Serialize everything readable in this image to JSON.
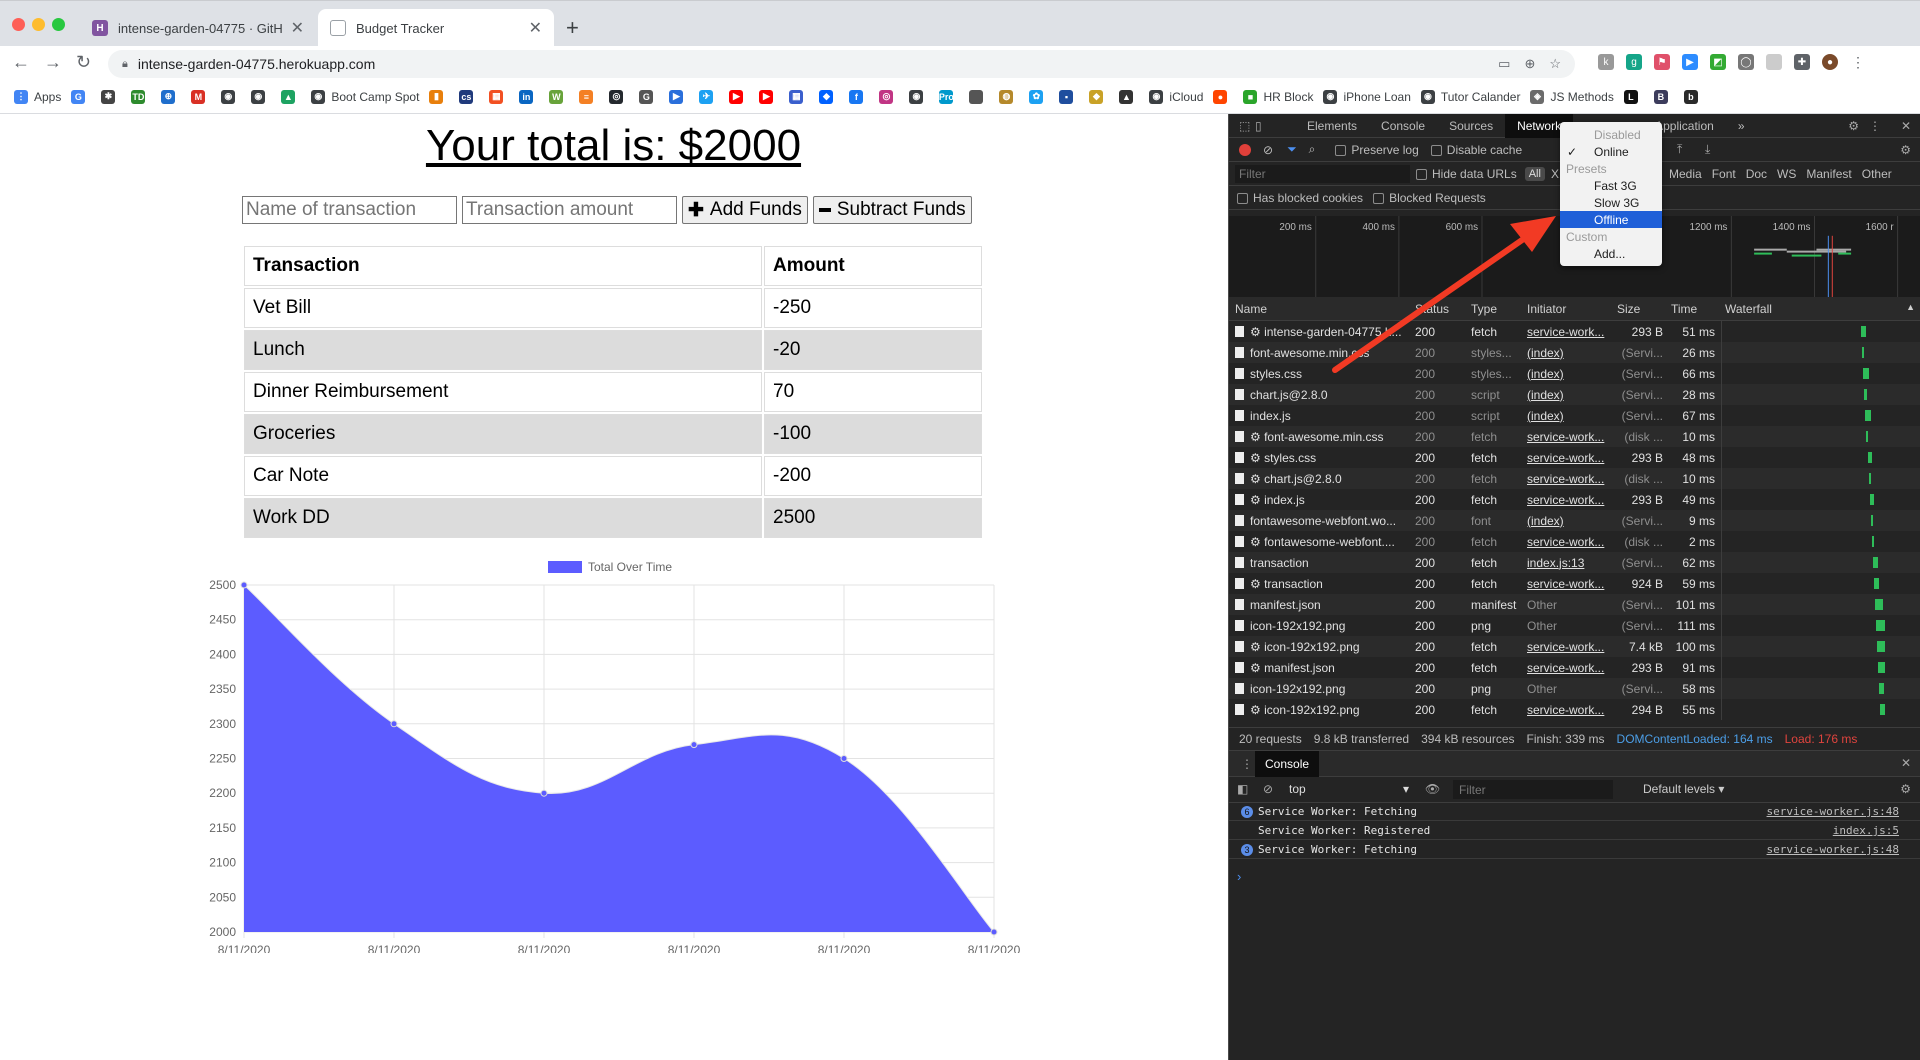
{
  "browser": {
    "tabs": [
      {
        "title": "intense-garden-04775 · GitHub",
        "favicon_color": "#8154a0",
        "favicon_letter": "H"
      },
      {
        "title": "Budget Tracker",
        "favicon_color": "#9aa0a6",
        "favicon_letter": ""
      }
    ],
    "url": "intense-garden-04775.herokuapp.com",
    "bookmarks": [
      {
        "label": "Apps",
        "color": "#4285f4",
        "letter": "⋮"
      },
      {
        "label": "",
        "color": "#4285f4",
        "letter": "G"
      },
      {
        "label": "",
        "color": "#444444",
        "letter": "✱"
      },
      {
        "label": "",
        "color": "#2e8b2e",
        "letter": "TD"
      },
      {
        "label": "",
        "color": "#1f6ecc",
        "letter": "⊕"
      },
      {
        "label": "",
        "color": "#d93025",
        "letter": "M"
      },
      {
        "label": "",
        "color": "#3c4043",
        "letter": "◉"
      },
      {
        "label": "",
        "color": "#3c4043",
        "letter": "◉"
      },
      {
        "label": "",
        "color": "#1ea362",
        "letter": "▲"
      },
      {
        "label": "Boot Camp Spot",
        "color": "#3c4043",
        "letter": "◉"
      },
      {
        "label": "",
        "color": "#e87f0c",
        "letter": "▮"
      },
      {
        "label": "",
        "color": "#203a7c",
        "letter": "cs"
      },
      {
        "label": "",
        "color": "#f25022",
        "letter": "▦"
      },
      {
        "label": "",
        "color": "#0a66c2",
        "letter": "in"
      },
      {
        "label": "",
        "color": "#68a33a",
        "letter": "W"
      },
      {
        "label": "",
        "color": "#f48024",
        "letter": "≡"
      },
      {
        "label": "",
        "color": "#24292e",
        "letter": "◎"
      },
      {
        "label": "",
        "color": "#555555",
        "letter": "G"
      },
      {
        "label": "",
        "color": "#2a6fdb",
        "letter": "▶"
      },
      {
        "label": "",
        "color": "#1da1f2",
        "letter": "✈"
      },
      {
        "label": "",
        "color": "#ff0000",
        "letter": "▶"
      },
      {
        "label": "",
        "color": "#ff0000",
        "letter": "▶"
      },
      {
        "label": "",
        "color": "#3a5fcd",
        "letter": "▦"
      },
      {
        "label": "",
        "color": "#0061ff",
        "letter": "◆"
      },
      {
        "label": "",
        "color": "#1877f2",
        "letter": "f"
      },
      {
        "label": "",
        "color": "#c13584",
        "letter": "◎"
      },
      {
        "label": "",
        "color": "#3c4043",
        "letter": "◉"
      },
      {
        "label": "",
        "color": "#0099cc",
        "letter": "Pro"
      },
      {
        "label": "",
        "color": "#555555",
        "letter": ""
      },
      {
        "label": "",
        "color": "#b5892b",
        "letter": "◍"
      },
      {
        "label": "",
        "color": "#1da1f2",
        "letter": "✿"
      },
      {
        "label": "",
        "color": "#1f4e9e",
        "letter": "▪"
      },
      {
        "label": "",
        "color": "#c9a227",
        "letter": "◆"
      },
      {
        "label": "",
        "color": "#333333",
        "letter": "▲"
      },
      {
        "label": "iCloud",
        "color": "#3c4043",
        "letter": "◉"
      },
      {
        "label": "",
        "color": "#ff4500",
        "letter": "●"
      },
      {
        "label": "HR Block",
        "color": "#2aa52a",
        "letter": "■"
      },
      {
        "label": "iPhone Loan",
        "color": "#3c4043",
        "letter": "◉"
      },
      {
        "label": "Tutor Calander",
        "color": "#3c4043",
        "letter": "◉"
      },
      {
        "label": "JS Methods",
        "color": "#6b6b6b",
        "letter": "◈"
      },
      {
        "label": "",
        "color": "#111111",
        "letter": "L"
      },
      {
        "label": "",
        "color": "#3c3c5c",
        "letter": "B"
      },
      {
        "label": "",
        "color": "#2a2a2a",
        "letter": "b"
      }
    ]
  },
  "app": {
    "total_text": "Your total is: $2000",
    "name_placeholder": "Name of transaction",
    "amount_placeholder": "Transaction amount",
    "add_label": "Add Funds",
    "subtract_label": "Subtract Funds",
    "columns": [
      "Transaction",
      "Amount"
    ],
    "rows": [
      {
        "name": "Vet Bill",
        "amount": "-250"
      },
      {
        "name": "Lunch",
        "amount": "-20"
      },
      {
        "name": "Dinner Reimbursement",
        "amount": "70"
      },
      {
        "name": "Groceries",
        "amount": "-100"
      },
      {
        "name": "Car Note",
        "amount": "-200"
      },
      {
        "name": "Work DD",
        "amount": "2500"
      }
    ]
  },
  "chart_data": {
    "type": "area",
    "legend": "Total Over Time",
    "color": "#5c5cff",
    "x": [
      "8/11/2020",
      "8/11/2020",
      "8/11/2020",
      "8/11/2020",
      "8/11/2020",
      "8/11/2020"
    ],
    "series": [
      {
        "name": "Total Over Time",
        "values": [
          2500,
          2300,
          2200,
          2270,
          2250,
          2000
        ]
      }
    ],
    "ylim": [
      2000,
      2500
    ],
    "yticks": [
      2500,
      2450,
      2400,
      2350,
      2300,
      2250,
      2200,
      2150,
      2100,
      2050,
      2000
    ],
    "grid": true,
    "legend_position": "top"
  },
  "devtools": {
    "tabs": [
      "Elements",
      "Console",
      "Sources",
      "Network",
      "Application"
    ],
    "preserve_log": "Preserve log",
    "disable_cache": "Disable cache",
    "filter_placeholder": "Filter",
    "hide_data_urls": "Hide data URLs",
    "all": "All",
    "xhr_trunc": "XH",
    "type_filters": [
      "Media",
      "Font",
      "Doc",
      "WS",
      "Manifest",
      "Other"
    ],
    "has_blocked_cookies": "Has blocked cookies",
    "blocked_requests": "Blocked Requests",
    "timeline_ticks": [
      "200 ms",
      "400 ms",
      "600 ms",
      "1200 ms",
      "1400 ms",
      "1600 r"
    ],
    "columns": [
      "Name",
      "Status",
      "Type",
      "Initiator",
      "Size",
      "Time",
      "Waterfall"
    ],
    "requests": [
      {
        "name": "⚙ intense-garden-04775.h...",
        "status": "200",
        "type": "fetch",
        "initiator": "service-work...",
        "size": "293 B",
        "time": "51 ms",
        "dim": false
      },
      {
        "name": "font-awesome.min.css",
        "status": "200",
        "type": "styles...",
        "initiator": "(index)",
        "size": "(Servi...",
        "time": "26 ms",
        "dim": true
      },
      {
        "name": "styles.css",
        "status": "200",
        "type": "styles...",
        "initiator": "(index)",
        "size": "(Servi...",
        "time": "66 ms",
        "dim": true
      },
      {
        "name": "chart.js@2.8.0",
        "status": "200",
        "type": "script",
        "initiator": "(index)",
        "size": "(Servi...",
        "time": "28 ms",
        "dim": true
      },
      {
        "name": "index.js",
        "status": "200",
        "type": "script",
        "initiator": "(index)",
        "size": "(Servi...",
        "time": "67 ms",
        "dim": true
      },
      {
        "name": "⚙ font-awesome.min.css",
        "status": "200",
        "type": "fetch",
        "initiator": "service-work...",
        "size": "(disk ...",
        "time": "10 ms",
        "dim": true
      },
      {
        "name": "⚙ styles.css",
        "status": "200",
        "type": "fetch",
        "initiator": "service-work...",
        "size": "293 B",
        "time": "48 ms",
        "dim": false
      },
      {
        "name": "⚙ chart.js@2.8.0",
        "status": "200",
        "type": "fetch",
        "initiator": "service-work...",
        "size": "(disk ...",
        "time": "10 ms",
        "dim": true
      },
      {
        "name": "⚙ index.js",
        "status": "200",
        "type": "fetch",
        "initiator": "service-work...",
        "size": "293 B",
        "time": "49 ms",
        "dim": false
      },
      {
        "name": "fontawesome-webfont.wo...",
        "status": "200",
        "type": "font",
        "initiator": "(index)",
        "size": "(Servi...",
        "time": "9 ms",
        "dim": true
      },
      {
        "name": "⚙ fontawesome-webfont....",
        "status": "200",
        "type": "fetch",
        "initiator": "service-work...",
        "size": "(disk ...",
        "time": "2 ms",
        "dim": true
      },
      {
        "name": "transaction",
        "status": "200",
        "type": "fetch",
        "initiator": "index.js:13",
        "size": "(Servi...",
        "time": "62 ms",
        "dim": false
      },
      {
        "name": "⚙ transaction",
        "status": "200",
        "type": "fetch",
        "initiator": "service-work...",
        "size": "924 B",
        "time": "59 ms",
        "dim": false
      },
      {
        "name": "manifest.json",
        "status": "200",
        "type": "manifest",
        "initiator": "Other",
        "size": "(Servi...",
        "time": "101 ms",
        "dim": false
      },
      {
        "name": "icon-192x192.png",
        "status": "200",
        "type": "png",
        "initiator": "Other",
        "size": "(Servi...",
        "time": "111 ms",
        "dim": false
      },
      {
        "name": "⚙ icon-192x192.png",
        "status": "200",
        "type": "fetch",
        "initiator": "service-work...",
        "size": "7.4 kB",
        "time": "100 ms",
        "dim": false
      },
      {
        "name": "⚙ manifest.json",
        "status": "200",
        "type": "fetch",
        "initiator": "service-work...",
        "size": "293 B",
        "time": "91 ms",
        "dim": false
      },
      {
        "name": "icon-192x192.png",
        "status": "200",
        "type": "png",
        "initiator": "Other",
        "size": "(Servi...",
        "time": "58 ms",
        "dim": false
      },
      {
        "name": "⚙ icon-192x192.png",
        "status": "200",
        "type": "fetch",
        "initiator": "service-work...",
        "size": "294 B",
        "time": "55 ms",
        "dim": false
      }
    ],
    "summary": {
      "requests": "20 requests",
      "transferred": "9.8 kB transferred",
      "resources": "394 kB resources",
      "finish": "Finish: 339 ms",
      "dcl": "DOMContentLoaded: 164 ms",
      "load": "Load: 176 ms"
    },
    "throttle_menu": {
      "disabled": "Disabled",
      "online": "Online",
      "presets": "Presets",
      "fast3g": "Fast 3G",
      "slow3g": "Slow 3G",
      "offline": "Offline",
      "custom": "Custom",
      "add": "Add..."
    },
    "console": {
      "tab": "Console",
      "context": "top",
      "filter_placeholder": "Filter",
      "levels": "Default levels ▾",
      "logs": [
        {
          "count": "6",
          "message": "Service Worker: Fetching",
          "source": "service-worker.js:48"
        },
        {
          "count": "",
          "message": "Service Worker: Registered",
          "source": "index.js:5"
        },
        {
          "count": "3",
          "message": "Service Worker: Fetching",
          "source": "service-worker.js:48"
        }
      ]
    }
  }
}
